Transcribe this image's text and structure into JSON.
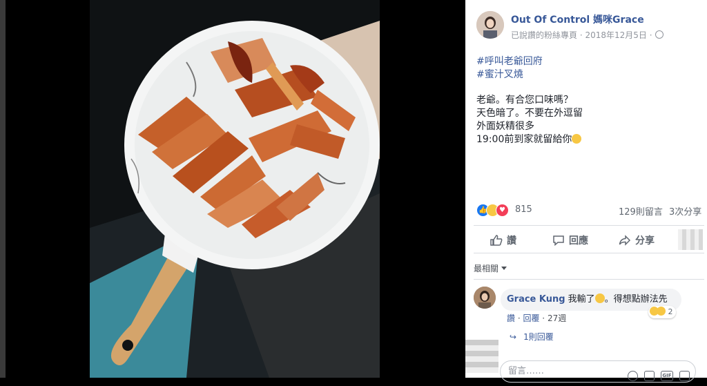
{
  "post": {
    "author": "Out Of Control 媽咪Grace",
    "meta": "已說讚的粉絲專頁 · 2018年12月5日 ·",
    "hashtags": [
      "#呼叫老爺回府",
      "#蜜汁叉燒"
    ],
    "lines": [
      "老爺。有合您口味嗎？",
      "天色暗了。不要在外逗留",
      "外面妖精很多",
      "19:00前到家就留給你"
    ]
  },
  "reactions": {
    "count": "815",
    "comments": "129則留言",
    "shares": "3次分享"
  },
  "actions": {
    "like": "讚",
    "comment": "回應",
    "share": "分享"
  },
  "sort_label": "最相關",
  "comment": {
    "name": "Grace Kung",
    "text_before": "我輸了",
    "text_after": "。得想點辦法先",
    "reaction_count": "2",
    "like": "讚",
    "reply": "回覆",
    "time": "27週",
    "replies": "1則回覆"
  },
  "composer": {
    "placeholder": "留言……",
    "gif_label": "GIF"
  },
  "colors": {
    "link_blue": "#385898",
    "secondary_text": "#90949c",
    "like_blue": "#1877f2",
    "love_red": "#f33e58",
    "emoji_yellow": "#f7c744"
  }
}
